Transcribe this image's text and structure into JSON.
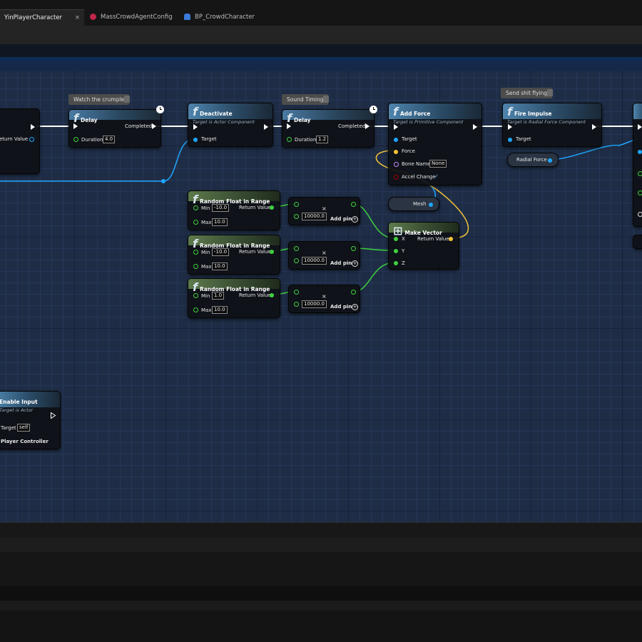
{
  "tabs": [
    {
      "label": "YinPlayerCharacter",
      "active": true,
      "close": "×"
    },
    {
      "label": "MassCrowdAgentConfig",
      "icon": "mass-config-icon",
      "icon_color": "#c2264a"
    },
    {
      "label": "BP_CrowdCharacter",
      "icon": "person-icon",
      "icon_color": "#3a7ad8"
    }
  ],
  "comments": {
    "watch": "Watch the crumple",
    "sound": "Sound Timing",
    "send": "Send shit flying"
  },
  "left_node": {
    "return_value": "eturn Value"
  },
  "delay1": {
    "title": "Delay",
    "completed": "Completed",
    "duration_label": "Duration",
    "duration": "4.0"
  },
  "deactivate": {
    "title": "Deactivate",
    "subtitle": "Target is Actor Component",
    "target": "Target"
  },
  "delay2": {
    "title": "Delay",
    "completed": "Completed",
    "duration_label": "Duration",
    "duration": "1.2"
  },
  "add_force": {
    "title": "Add Force",
    "subtitle": "Target is Primitive Component",
    "target": "Target",
    "force": "Force",
    "bone_name": "Bone Name",
    "bone_value": "None",
    "accel_change": "Accel Change",
    "check": "✓"
  },
  "fire_impulse": {
    "title": "Fire Impulse",
    "subtitle": "Target is Radial Force Component",
    "target": "Target"
  },
  "radial_force": {
    "label": "Radial Force"
  },
  "mesh": {
    "label": "Mesh"
  },
  "make_vector": {
    "title": "Make Vector",
    "x": "X",
    "y": "Y",
    "z": "Z",
    "return_value": "Return Value"
  },
  "random_nodes": [
    {
      "title": "Random Float in Range",
      "min_label": "Min",
      "min": "-10.0",
      "max_label": "Max",
      "max": "10.0",
      "return_value": "Return Value"
    },
    {
      "title": "Random Float in Range",
      "min_label": "Min",
      "min": "-10.0",
      "max_label": "Max",
      "max": "10.0",
      "return_value": "Return Value"
    },
    {
      "title": "Random Float in Range",
      "min_label": "Min",
      "min": "1.0",
      "max_label": "Max",
      "max": "10.0",
      "return_value": "Return Value"
    }
  ],
  "multiply_nodes": [
    {
      "value": "10000.0",
      "add_pin": "Add pin",
      "op": "×"
    },
    {
      "value": "10000.0",
      "add_pin": "Add pin",
      "op": "×"
    },
    {
      "value": "10000.0",
      "add_pin": "Add pin",
      "op": "×"
    }
  ],
  "enable_input": {
    "title": "Enable Input",
    "subtitle": "Target is Actor",
    "target": "Target",
    "target_value": "self",
    "player_controller": "Player Controller"
  },
  "colors": {
    "exec": "#ffffff",
    "object_pin": "#1ea7ff",
    "float_pin": "#3fd13f",
    "vector_pin": "#f5c43a",
    "name_pin": "#c58cff",
    "bool_pin": "#a00000"
  }
}
